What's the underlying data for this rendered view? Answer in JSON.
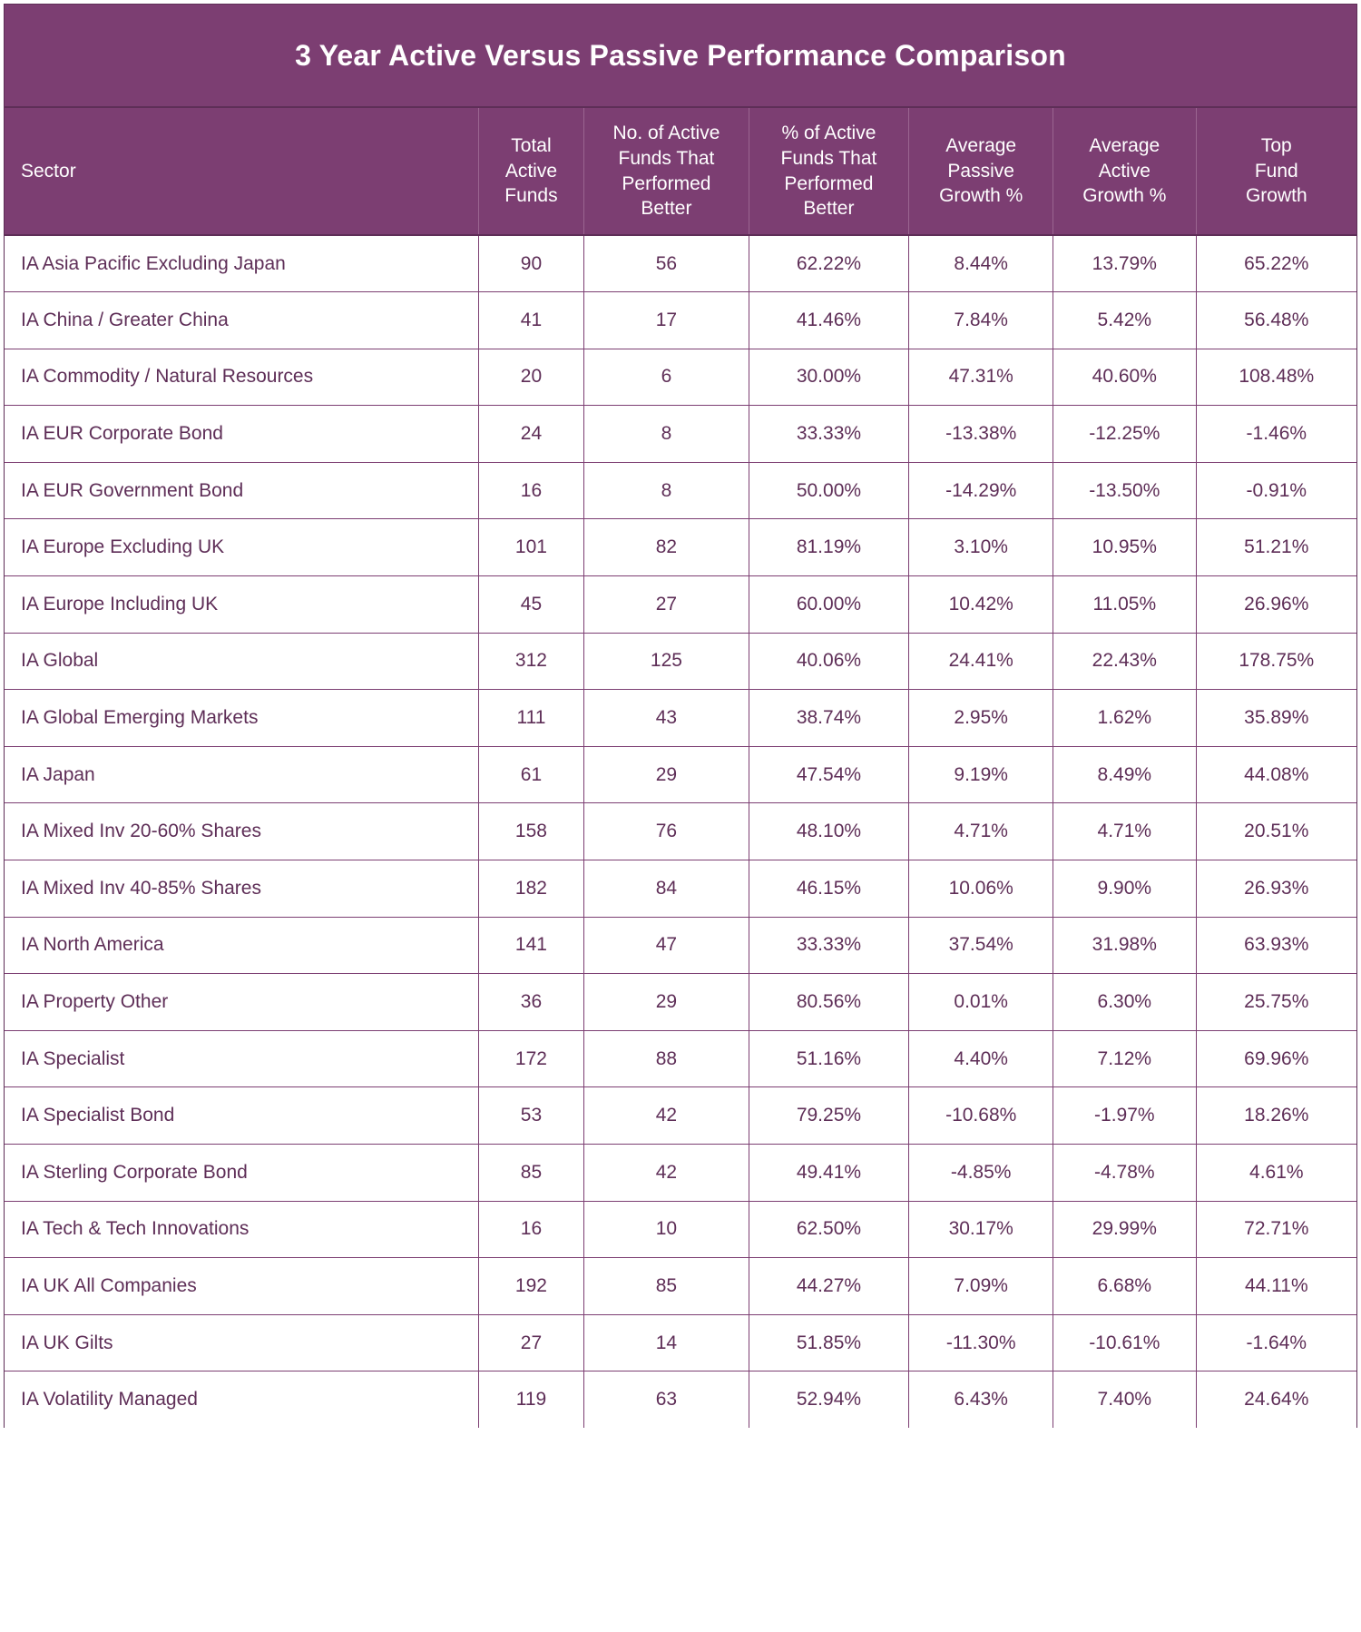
{
  "title": "3 Year Active Versus Passive Performance Comparison",
  "colors": {
    "header_purple": "#7C3E72",
    "border_dark": "#5E2E57",
    "text_purple": "#5E2E57",
    "header_text": "#FFFFFF",
    "row_background": "#FFFFFF"
  },
  "chart_data": {
    "type": "table",
    "title": "3 Year Active Versus Passive Performance Comparison",
    "columns": [
      "Sector",
      "Total Active Funds",
      "No. of Active Funds That Performed Better",
      "% of Active Funds That Performed Better",
      "Average Passive Growth %",
      "Average Active Growth %",
      "Top Fund Growth"
    ],
    "rows": [
      [
        "IA Asia Pacific Excluding Japan",
        "90",
        "56",
        "62.22%",
        "8.44%",
        "13.79%",
        "65.22%"
      ],
      [
        "IA China / Greater China",
        "41",
        "17",
        "41.46%",
        "7.84%",
        "5.42%",
        "56.48%"
      ],
      [
        "IA Commodity / Natural Resources",
        "20",
        "6",
        "30.00%",
        "47.31%",
        "40.60%",
        "108.48%"
      ],
      [
        "IA EUR Corporate Bond",
        "24",
        "8",
        "33.33%",
        "-13.38%",
        "-12.25%",
        "-1.46%"
      ],
      [
        "IA EUR Government Bond",
        "16",
        "8",
        "50.00%",
        "-14.29%",
        "-13.50%",
        "-0.91%"
      ],
      [
        "IA Europe Excluding UK",
        "101",
        "82",
        "81.19%",
        "3.10%",
        "10.95%",
        "51.21%"
      ],
      [
        "IA Europe Including UK",
        "45",
        "27",
        "60.00%",
        "10.42%",
        "11.05%",
        "26.96%"
      ],
      [
        "IA Global",
        "312",
        "125",
        "40.06%",
        "24.41%",
        "22.43%",
        "178.75%"
      ],
      [
        "IA Global Emerging Markets",
        "111",
        "43",
        "38.74%",
        "2.95%",
        "1.62%",
        "35.89%"
      ],
      [
        "IA Japan",
        "61",
        "29",
        "47.54%",
        "9.19%",
        "8.49%",
        "44.08%"
      ],
      [
        "IA Mixed Inv 20-60% Shares",
        "158",
        "76",
        "48.10%",
        "4.71%",
        "4.71%",
        "20.51%"
      ],
      [
        "IA Mixed Inv 40-85% Shares",
        "182",
        "84",
        "46.15%",
        "10.06%",
        "9.90%",
        "26.93%"
      ],
      [
        "IA North America",
        "141",
        "47",
        "33.33%",
        "37.54%",
        "31.98%",
        "63.93%"
      ],
      [
        "IA Property Other",
        "36",
        "29",
        "80.56%",
        "0.01%",
        "6.30%",
        "25.75%"
      ],
      [
        "IA Specialist",
        "172",
        "88",
        "51.16%",
        "4.40%",
        "7.12%",
        "69.96%"
      ],
      [
        "IA Specialist Bond",
        "53",
        "42",
        "79.25%",
        "-10.68%",
        "-1.97%",
        "18.26%"
      ],
      [
        "IA Sterling Corporate Bond",
        "85",
        "42",
        "49.41%",
        "-4.85%",
        "-4.78%",
        "4.61%"
      ],
      [
        "IA Tech & Tech Innovations",
        "16",
        "10",
        "62.50%",
        "30.17%",
        "29.99%",
        "72.71%"
      ],
      [
        "IA UK All Companies",
        "192",
        "85",
        "44.27%",
        "7.09%",
        "6.68%",
        "44.11%"
      ],
      [
        "IA UK Gilts",
        "27",
        "14",
        "51.85%",
        "-11.30%",
        "-10.61%",
        "-1.64%"
      ],
      [
        "IA Volatility Managed",
        "119",
        "63",
        "52.94%",
        "6.43%",
        "7.40%",
        "24.64%"
      ]
    ]
  },
  "header": {
    "sector": "Sector",
    "total_active_funds": [
      "Total",
      "Active",
      "Funds"
    ],
    "no_active_better": [
      "No. of Active",
      "Funds That",
      "Performed",
      "Better"
    ],
    "pct_active_better": [
      "% of Active",
      "Funds That",
      "Performed",
      "Better"
    ],
    "avg_passive_growth": [
      "Average",
      "Passive",
      "Growth %"
    ],
    "avg_active_growth": [
      "Average",
      "Active",
      "Growth %"
    ],
    "top_fund_growth": [
      "Top",
      "Fund",
      "Growth"
    ]
  }
}
